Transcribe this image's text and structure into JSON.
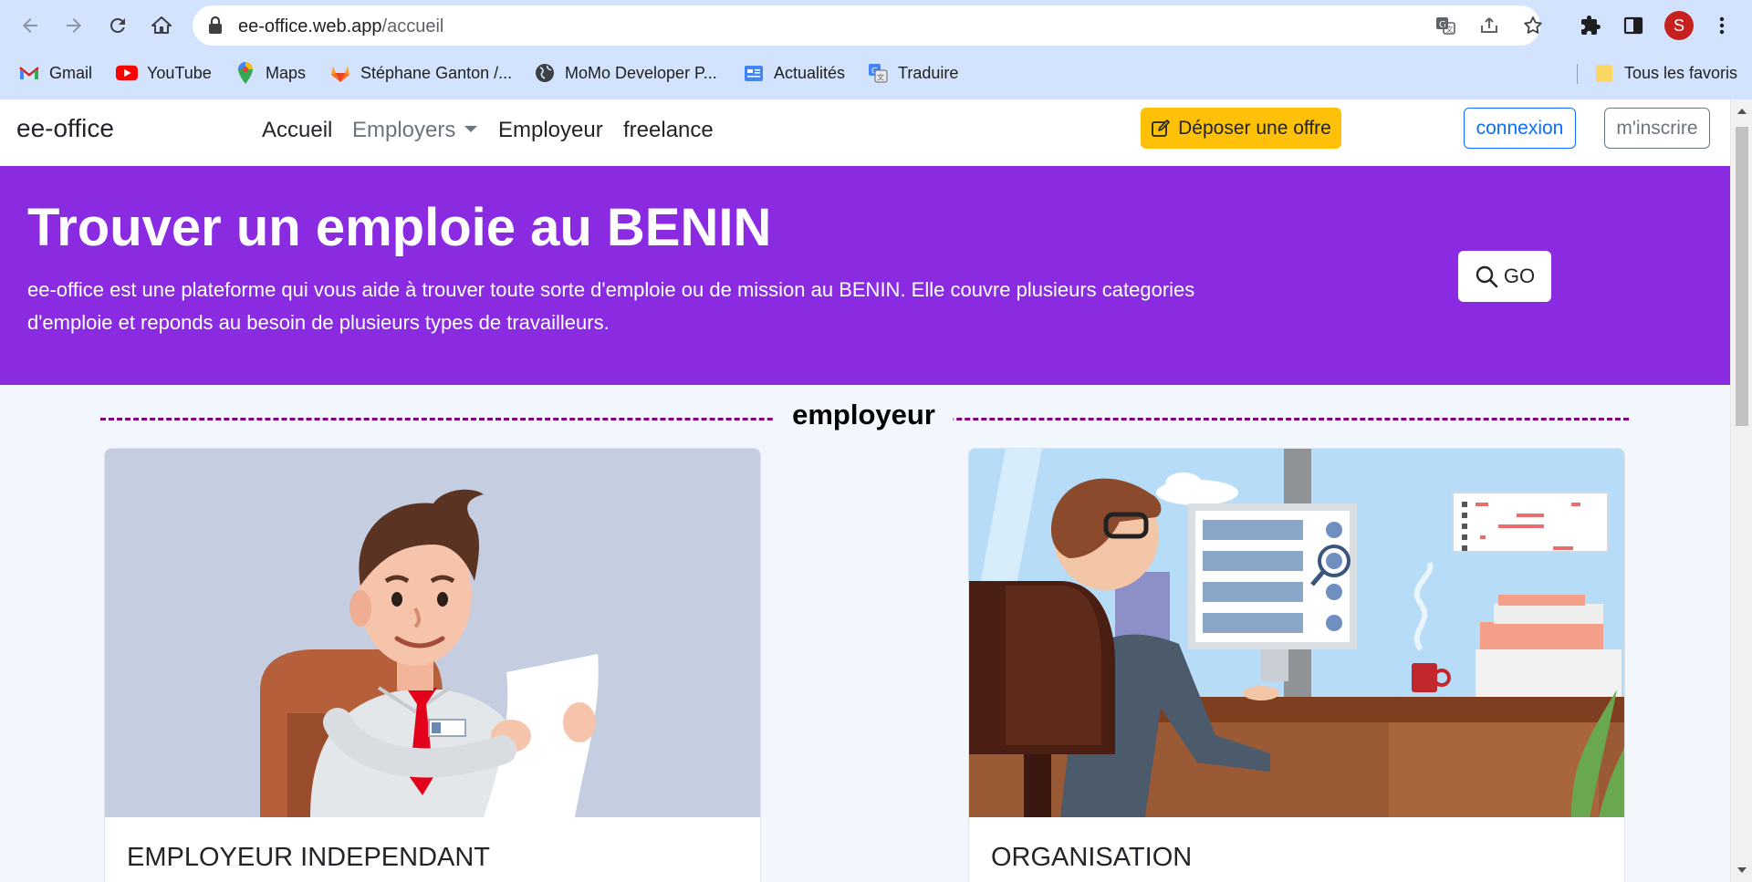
{
  "browser": {
    "url_host": "ee-office.web.app",
    "url_path": "/accueil",
    "profile_initial": "S",
    "bookmarks": [
      {
        "label": "Gmail",
        "icon": "gmail-icon"
      },
      {
        "label": "YouTube",
        "icon": "youtube-icon"
      },
      {
        "label": "Maps",
        "icon": "maps-icon"
      },
      {
        "label": "Stéphane Ganton /...",
        "icon": "gitlab-icon"
      },
      {
        "label": "MoMo Developer P...",
        "icon": "globe-icon"
      },
      {
        "label": "Actualités",
        "icon": "news-icon"
      },
      {
        "label": "Traduire",
        "icon": "translate-icon"
      }
    ],
    "all_bookmarks_label": "Tous les favoris"
  },
  "navbar": {
    "brand": "ee-office",
    "links": [
      "Accueil",
      "Employers",
      "Employeur",
      "freelance"
    ],
    "post_offer": "Déposer une offre",
    "login": "connexion",
    "register": "m'inscrire"
  },
  "hero": {
    "title": "Trouver un emploie au BENIN",
    "description": "ee-office est une plateforme qui vous aide à trouver toute sorte d'emploie ou de mission au BENIN. Elle couvre plusieurs categories d'emploie et reponds au besoin de plusieurs types de travailleurs.",
    "go_button": "GO"
  },
  "section": {
    "title": "employeur"
  },
  "cards": [
    {
      "title": "EMPLOYEUR INDEPENDANT"
    },
    {
      "title": "ORGANISATION"
    }
  ],
  "colors": {
    "hero_bg": "#8a2be2",
    "offer_button": "#ffc107",
    "login_border": "#0d6efd",
    "section_line": "#800080",
    "browser_chrome": "#d3e3fd"
  }
}
